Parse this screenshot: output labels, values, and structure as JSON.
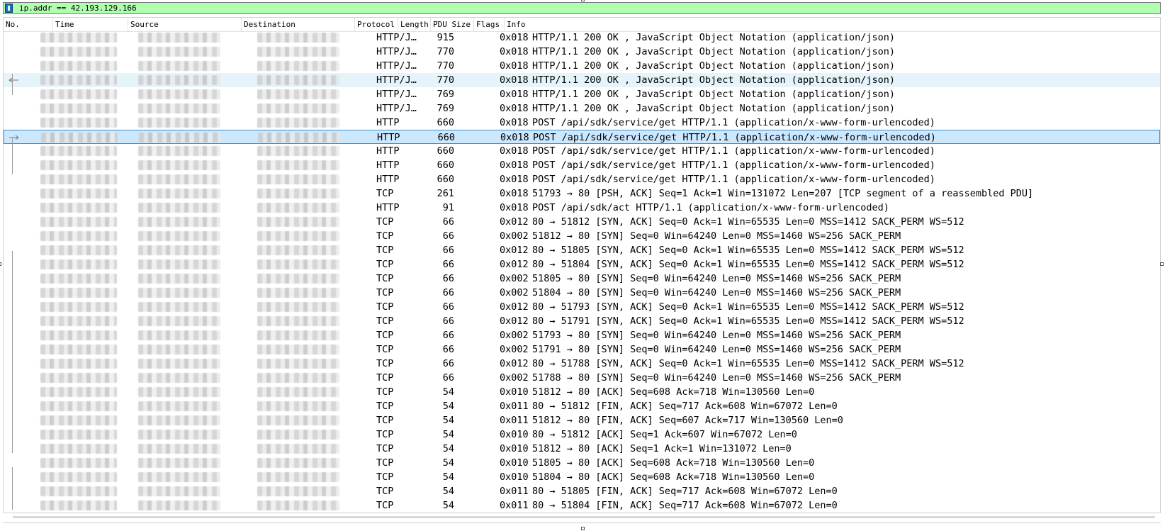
{
  "display_filter": {
    "value": "ip.addr == 42.193.129.166"
  },
  "columns": {
    "no": "No.",
    "time": "Time",
    "source": "Source",
    "destination": "Destination",
    "protocol": "Protocol",
    "length": "Length",
    "pdu_size": "PDU Size",
    "flags": "Flags",
    "info": "Info"
  },
  "sort": {
    "column": "length",
    "direction": "descending"
  },
  "selection": {
    "selected_row": 7,
    "hover_row": 3
  },
  "colors": {
    "filter_valid": "#afffaf",
    "selected_row": "#cce8ff",
    "hover_row": "#e5f3fb"
  },
  "packets": [
    {
      "protocol": "HTTP/J…",
      "length": "915",
      "flags": "0x018",
      "info": "HTTP/1.1 200 OK , JavaScript Object Notation (application/json)"
    },
    {
      "protocol": "HTTP/J…",
      "length": "770",
      "flags": "0x018",
      "info": "HTTP/1.1 200 OK , JavaScript Object Notation (application/json)"
    },
    {
      "protocol": "HTTP/J…",
      "length": "770",
      "flags": "0x018",
      "info": "HTTP/1.1 200 OK , JavaScript Object Notation (application/json)"
    },
    {
      "protocol": "HTTP/J…",
      "length": "770",
      "flags": "0x018",
      "info": "HTTP/1.1 200 OK , JavaScript Object Notation (application/json)"
    },
    {
      "protocol": "HTTP/J…",
      "length": "769",
      "flags": "0x018",
      "info": "HTTP/1.1 200 OK , JavaScript Object Notation (application/json)"
    },
    {
      "protocol": "HTTP/J…",
      "length": "769",
      "flags": "0x018",
      "info": "HTTP/1.1 200 OK , JavaScript Object Notation (application/json)"
    },
    {
      "protocol": "HTTP",
      "length": "660",
      "flags": "0x018",
      "info": "POST /api/sdk/service/get HTTP/1.1  (application/x-www-form-urlencoded)"
    },
    {
      "protocol": "HTTP",
      "length": "660",
      "flags": "0x018",
      "info": "POST /api/sdk/service/get HTTP/1.1  (application/x-www-form-urlencoded)"
    },
    {
      "protocol": "HTTP",
      "length": "660",
      "flags": "0x018",
      "info": "POST /api/sdk/service/get HTTP/1.1  (application/x-www-form-urlencoded)"
    },
    {
      "protocol": "HTTP",
      "length": "660",
      "flags": "0x018",
      "info": "POST /api/sdk/service/get HTTP/1.1  (application/x-www-form-urlencoded)"
    },
    {
      "protocol": "HTTP",
      "length": "660",
      "flags": "0x018",
      "info": "POST /api/sdk/service/get HTTP/1.1  (application/x-www-form-urlencoded)"
    },
    {
      "protocol": "TCP",
      "length": "261",
      "flags": "0x018",
      "info": "51793 → 80 [PSH, ACK] Seq=1 Ack=1 Win=131072 Len=207 [TCP segment of a reassembled PDU]"
    },
    {
      "protocol": "HTTP",
      "length": "91",
      "flags": "0x018",
      "info": "POST /api/sdk/act HTTP/1.1  (application/x-www-form-urlencoded)"
    },
    {
      "protocol": "TCP",
      "length": "66",
      "flags": "0x012",
      "info": "80 → 51812 [SYN, ACK] Seq=0 Ack=1 Win=65535 Len=0 MSS=1412 SACK_PERM WS=512"
    },
    {
      "protocol": "TCP",
      "length": "66",
      "flags": "0x002",
      "info": "51812 → 80 [SYN] Seq=0 Win=64240 Len=0 MSS=1460 WS=256 SACK_PERM"
    },
    {
      "protocol": "TCP",
      "length": "66",
      "flags": "0x012",
      "info": "80 → 51805 [SYN, ACK] Seq=0 Ack=1 Win=65535 Len=0 MSS=1412 SACK_PERM WS=512"
    },
    {
      "protocol": "TCP",
      "length": "66",
      "flags": "0x012",
      "info": "80 → 51804 [SYN, ACK] Seq=0 Ack=1 Win=65535 Len=0 MSS=1412 SACK_PERM WS=512"
    },
    {
      "protocol": "TCP",
      "length": "66",
      "flags": "0x002",
      "info": "51805 → 80 [SYN] Seq=0 Win=64240 Len=0 MSS=1460 WS=256 SACK_PERM"
    },
    {
      "protocol": "TCP",
      "length": "66",
      "flags": "0x002",
      "info": "51804 → 80 [SYN] Seq=0 Win=64240 Len=0 MSS=1460 WS=256 SACK_PERM"
    },
    {
      "protocol": "TCP",
      "length": "66",
      "flags": "0x012",
      "info": "80 → 51793 [SYN, ACK] Seq=0 Ack=1 Win=65535 Len=0 MSS=1412 SACK_PERM WS=512"
    },
    {
      "protocol": "TCP",
      "length": "66",
      "flags": "0x012",
      "info": "80 → 51791 [SYN, ACK] Seq=0 Ack=1 Win=65535 Len=0 MSS=1412 SACK_PERM WS=512"
    },
    {
      "protocol": "TCP",
      "length": "66",
      "flags": "0x002",
      "info": "51793 → 80 [SYN] Seq=0 Win=64240 Len=0 MSS=1460 WS=256 SACK_PERM"
    },
    {
      "protocol": "TCP",
      "length": "66",
      "flags": "0x002",
      "info": "51791 → 80 [SYN] Seq=0 Win=64240 Len=0 MSS=1460 WS=256 SACK_PERM"
    },
    {
      "protocol": "TCP",
      "length": "66",
      "flags": "0x012",
      "info": "80 → 51788 [SYN, ACK] Seq=0 Ack=1 Win=65535 Len=0 MSS=1412 SACK_PERM WS=512"
    },
    {
      "protocol": "TCP",
      "length": "66",
      "flags": "0x002",
      "info": "51788 → 80 [SYN] Seq=0 Win=64240 Len=0 MSS=1460 WS=256 SACK_PERM"
    },
    {
      "protocol": "TCP",
      "length": "54",
      "flags": "0x010",
      "info": "51812 → 80 [ACK] Seq=608 Ack=718 Win=130560 Len=0"
    },
    {
      "protocol": "TCP",
      "length": "54",
      "flags": "0x011",
      "info": "80 → 51812 [FIN, ACK] Seq=717 Ack=608 Win=67072 Len=0"
    },
    {
      "protocol": "TCP",
      "length": "54",
      "flags": "0x011",
      "info": "51812 → 80 [FIN, ACK] Seq=607 Ack=717 Win=130560 Len=0"
    },
    {
      "protocol": "TCP",
      "length": "54",
      "flags": "0x010",
      "info": "80 → 51812 [ACK] Seq=1 Ack=607 Win=67072 Len=0"
    },
    {
      "protocol": "TCP",
      "length": "54",
      "flags": "0x010",
      "info": "51812 → 80 [ACK] Seq=1 Ack=1 Win=131072 Len=0"
    },
    {
      "protocol": "TCP",
      "length": "54",
      "flags": "0x010",
      "info": "51805 → 80 [ACK] Seq=608 Ack=718 Win=130560 Len=0"
    },
    {
      "protocol": "TCP",
      "length": "54",
      "flags": "0x010",
      "info": "51804 → 80 [ACK] Seq=608 Ack=718 Win=130560 Len=0"
    },
    {
      "protocol": "TCP",
      "length": "54",
      "flags": "0x011",
      "info": "80 → 51805 [FIN, ACK] Seq=717 Ack=608 Win=67072 Len=0"
    },
    {
      "protocol": "TCP",
      "length": "54",
      "flags": "0x011",
      "info": "80 → 51804 [FIN, ACK] Seq=717 Ack=608 Win=67072 Len=0"
    }
  ]
}
